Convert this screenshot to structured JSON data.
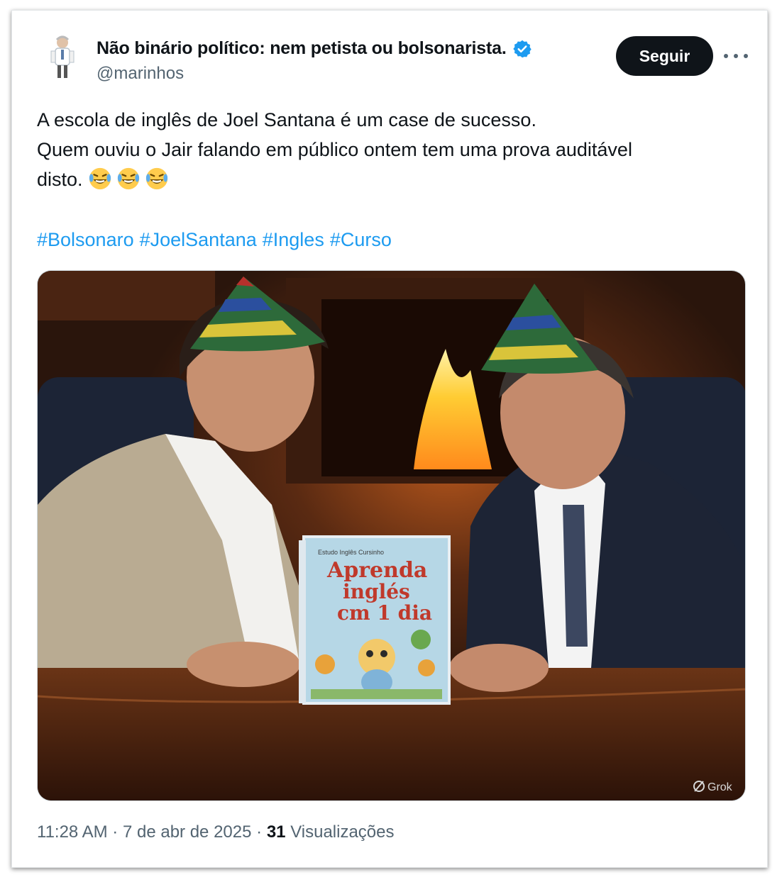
{
  "tweet": {
    "author_name": "Não binário político: nem petista ou bolsonarista.",
    "handle": "@marinhos",
    "follow_label": "Seguir",
    "more_icon": "more-horizontal-icon",
    "verified_icon": "verified-badge-icon",
    "text_lines": [
      "A escola de inglês de Joel Santana é um case de sucesso.",
      "Quem ouviu o Jair falando em público ontem tem uma prova auditável",
      "disto."
    ],
    "emoji_count": 3,
    "hashtags": [
      "#Bolsonaro",
      "#JoelSantana",
      "#Ingles",
      "#Curso"
    ],
    "image": {
      "book_line1": "Aprenda",
      "book_line2": "inglés",
      "book_line3": "cm 1 dia",
      "book_top": "Estudo Inglês Cursinho",
      "watermark": "Grok"
    },
    "time": "11:28 AM",
    "date": "7 de abr de 2025",
    "views_count": "31",
    "views_label": "Visualizações",
    "separator": "·"
  },
  "colors": {
    "link": "#1d9bf0",
    "verified": "#1d9bf0",
    "button_bg": "#0f1419",
    "secondary_text": "#536471"
  }
}
